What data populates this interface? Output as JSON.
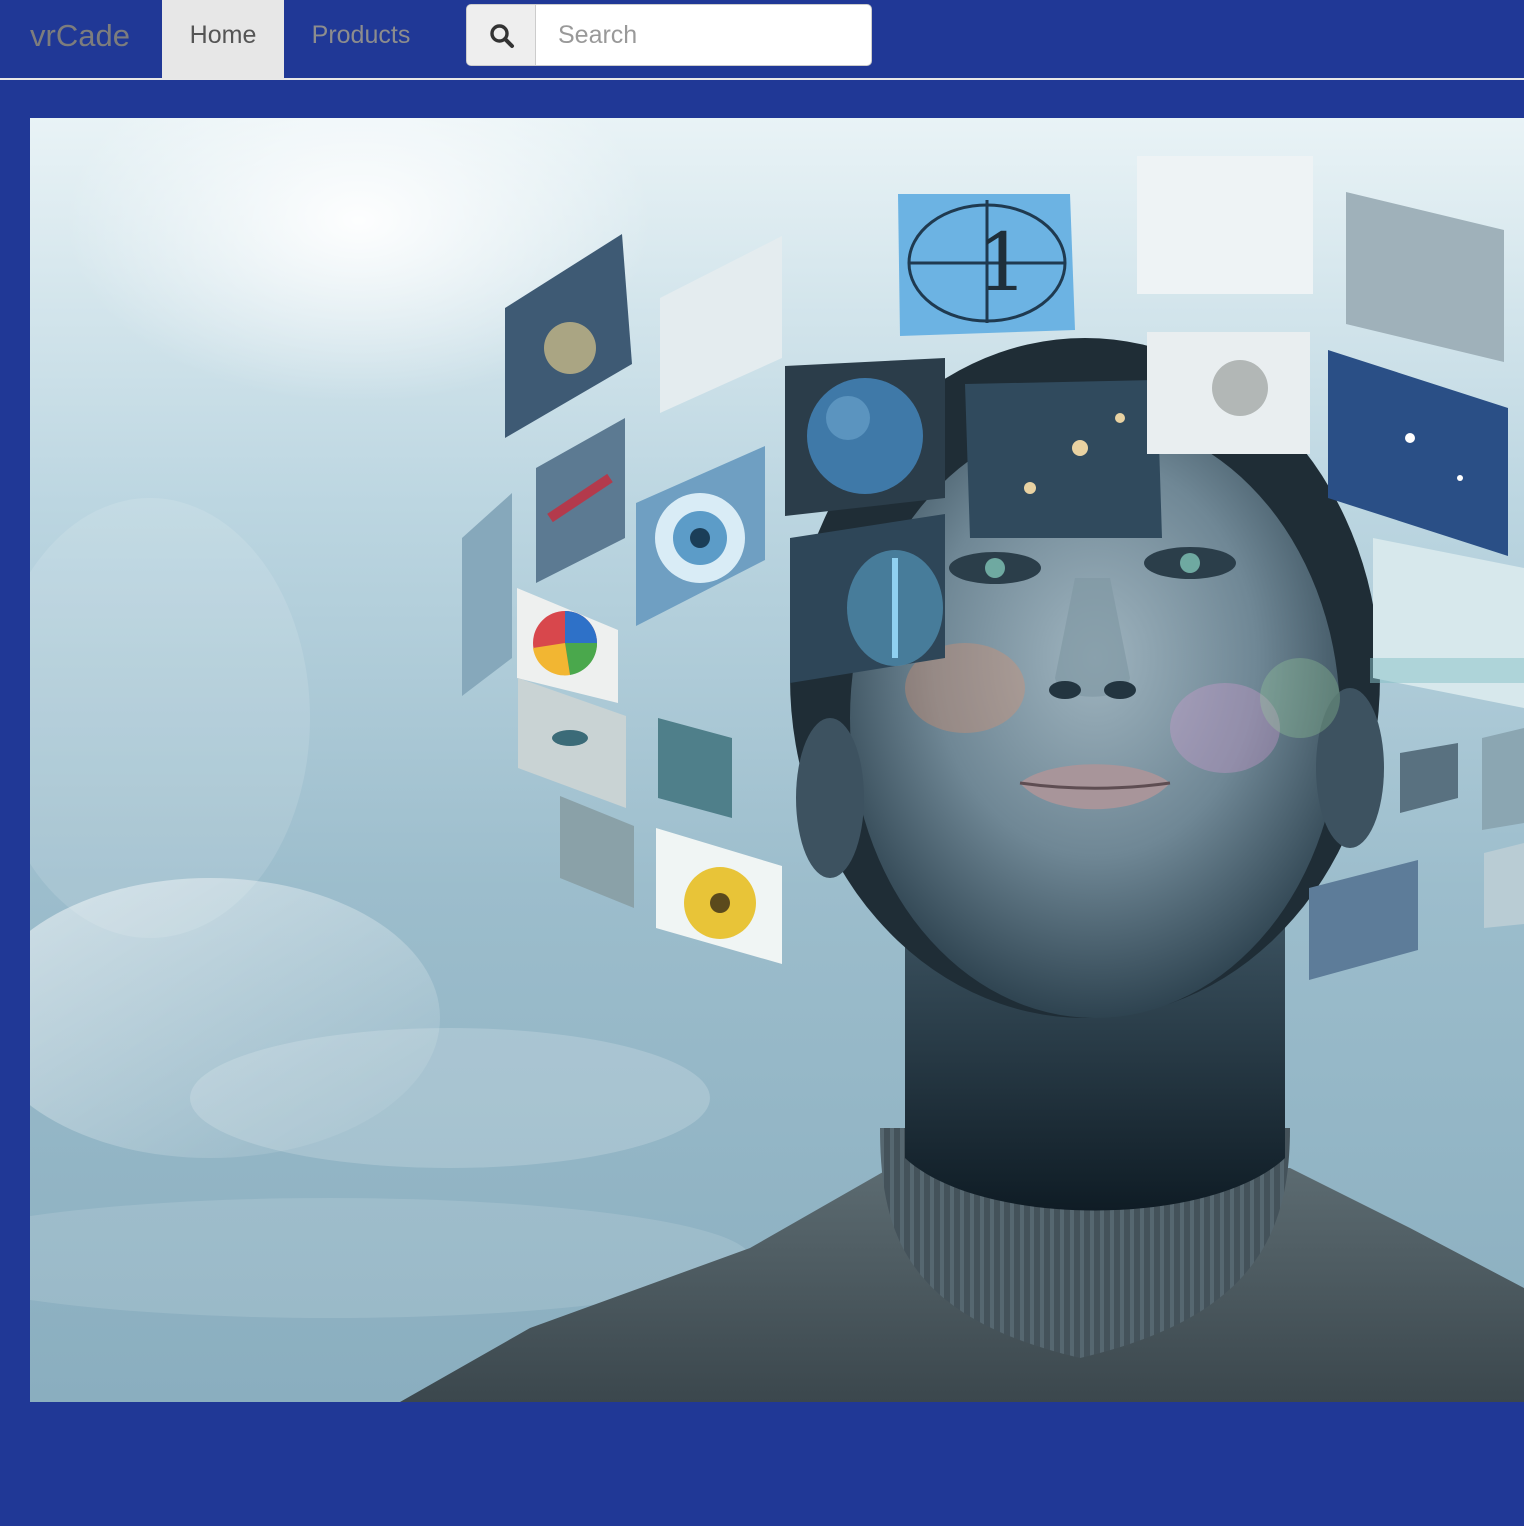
{
  "navbar": {
    "brand": "vrCade",
    "items": [
      {
        "label": "Home",
        "active": true
      },
      {
        "label": "Products",
        "active": false
      }
    ],
    "search": {
      "placeholder": "Search",
      "value": "",
      "icon": "search-icon"
    }
  },
  "colors": {
    "page_background": "#203896",
    "active_nav_background": "#e7e7e7",
    "brand_text": "#7d7d7d"
  },
  "hero": {
    "image": "hero-image"
  }
}
